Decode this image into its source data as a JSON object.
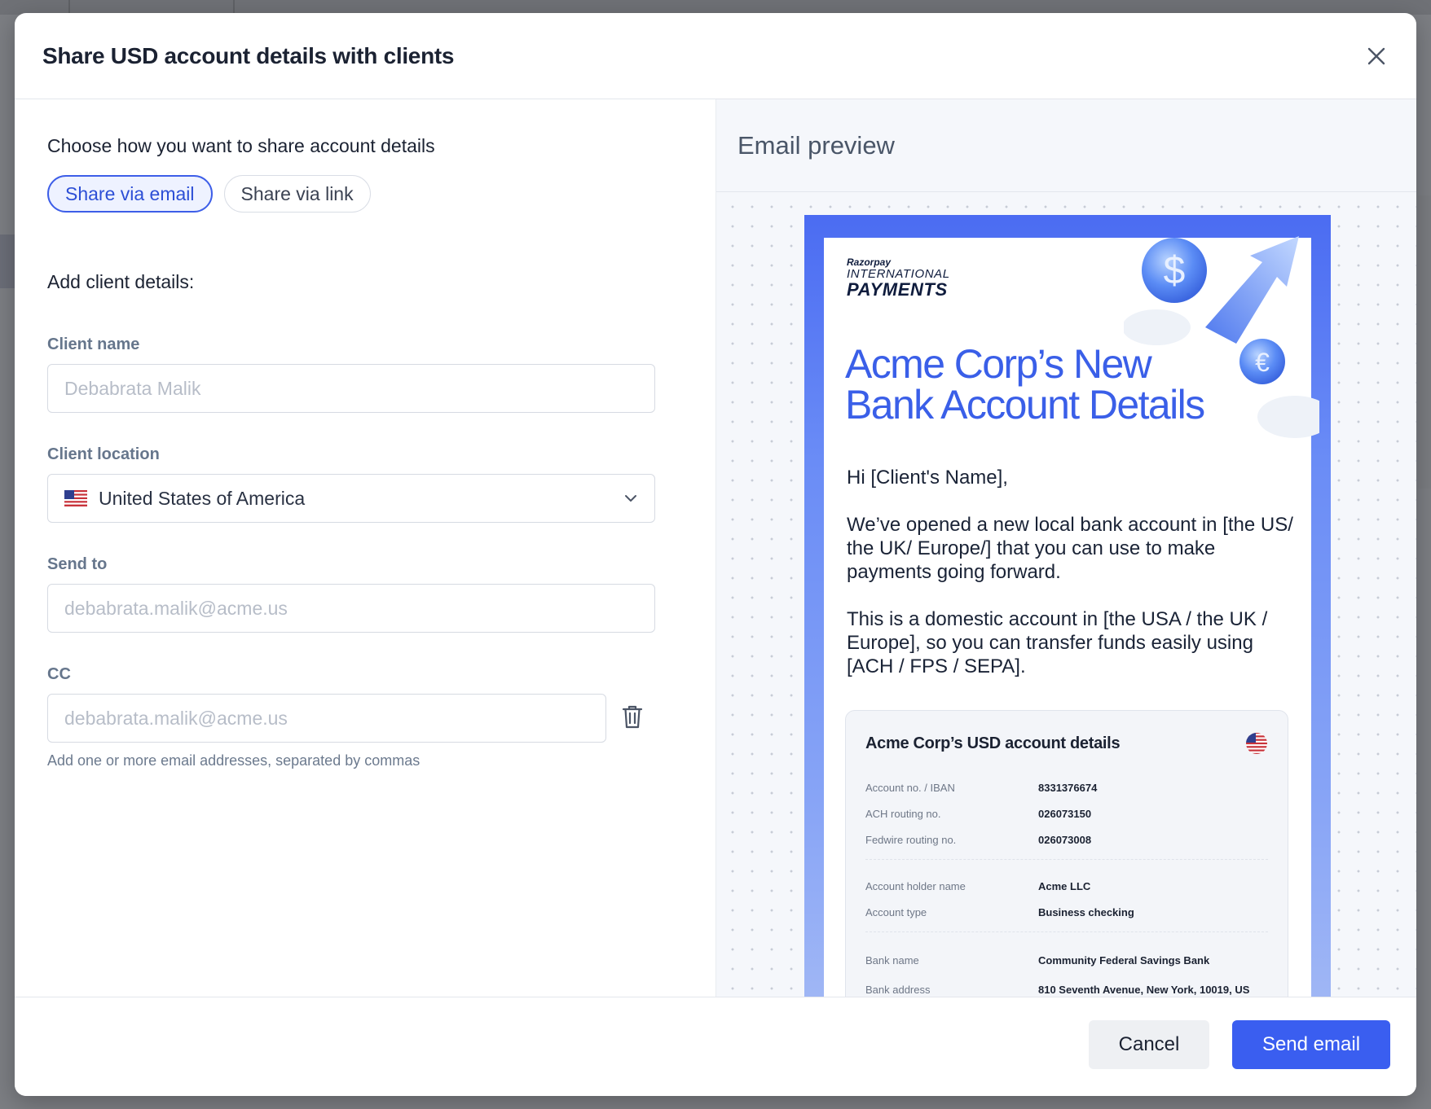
{
  "modal": {
    "title": "Share USD account details with clients"
  },
  "share": {
    "heading": "Choose how you want to share account details",
    "options": [
      {
        "label": "Share via email",
        "active": true
      },
      {
        "label": "Share via link",
        "active": false
      }
    ]
  },
  "client": {
    "heading": "Add client details:",
    "name_label": "Client name",
    "name_placeholder": "Debabrata Malik",
    "location_label": "Client location",
    "location_value": "United States of America",
    "send_to_label": "Send to",
    "send_to_placeholder": "debabrata.malik@acme.us",
    "cc_label": "CC",
    "cc_placeholder": "debabrata.malik@acme.us",
    "cc_help": "Add one or more email addresses, separated by commas"
  },
  "preview": {
    "heading": "Email preview",
    "logo": {
      "line1": "Razorpay",
      "line2": "INTERNATIONAL",
      "line3": "PAYMENTS"
    },
    "headline": "Acme Corp’s New Bank Account Details",
    "greeting": "Hi [Client's Name],",
    "paragraph1": "We’ve opened a new local bank account in [the US/ the UK/ Europe/] that you can use to make payments going forward.",
    "paragraph2": "This is a domestic account in [the USA / the UK / Europe], so you can transfer funds easily using [ACH / FPS / SEPA].",
    "account_card": {
      "title": "Acme Corp’s USD account details",
      "group1": [
        {
          "label": "Account no. / IBAN",
          "value": "8331376674"
        },
        {
          "label": "ACH routing no.",
          "value": "026073150"
        },
        {
          "label": "Fedwire routing no.",
          "value": "026073008"
        }
      ],
      "group2": [
        {
          "label": "Account holder name",
          "value": "Acme LLC"
        },
        {
          "label": "Account type",
          "value": "Business checking"
        }
      ],
      "group3": [
        {
          "label": "Bank name",
          "value": "Community Federal Savings Bank"
        },
        {
          "label": "Bank address",
          "value": "810 Seventh Avenue, New York, 10019, US"
        }
      ]
    }
  },
  "footer": {
    "cancel_label": "Cancel",
    "send_label": "Send email"
  },
  "colors": {
    "accent": "#3a5ef0",
    "headline": "#3a5fe8"
  },
  "icons": {
    "close": "close-icon",
    "chevron": "chevron-down-icon",
    "trash": "trash-icon",
    "flag": "us-flag-icon"
  }
}
